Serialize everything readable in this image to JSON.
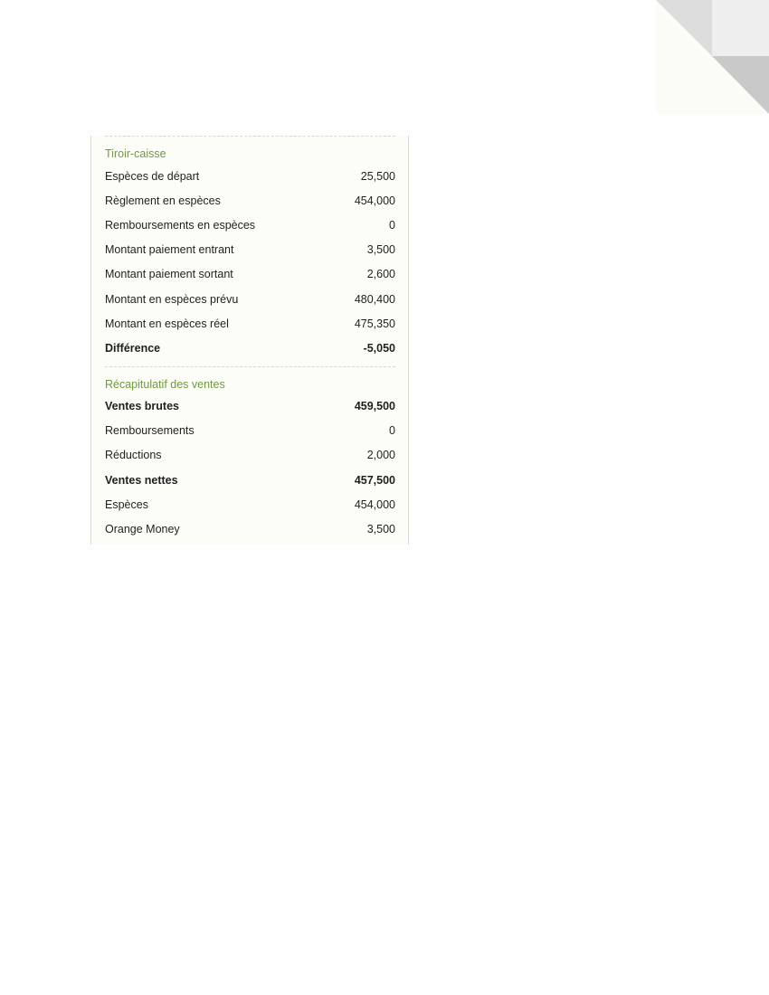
{
  "drawer": {
    "title": "Tiroir-caisse",
    "rows": [
      {
        "label": "Espèces de départ",
        "value": "25,500",
        "bold": false
      },
      {
        "label": "Règlement en espèces",
        "value": "454,000",
        "bold": false
      },
      {
        "label": "Remboursements en espèces",
        "value": "0",
        "bold": false
      },
      {
        "label": "Montant paiement entrant",
        "value": "3,500",
        "bold": false
      },
      {
        "label": "Montant paiement sortant",
        "value": "2,600",
        "bold": false
      },
      {
        "label": "Montant en espèces prévu",
        "value": "480,400",
        "bold": false
      },
      {
        "label": "Montant en espèces réel",
        "value": "475,350",
        "bold": false
      },
      {
        "label": "Différence",
        "value": "-5,050",
        "bold": true
      }
    ]
  },
  "sales_summary": {
    "title": "Récapitulatif des ventes",
    "rows": [
      {
        "label": "Ventes brutes",
        "value": "459,500",
        "bold": true
      },
      {
        "label": "Remboursements",
        "value": "0",
        "bold": false
      },
      {
        "label": "Réductions",
        "value": "2,000",
        "bold": false
      },
      {
        "label": "Ventes nettes",
        "value": "457,500",
        "bold": true
      },
      {
        "label": "Espèces",
        "value": "454,000",
        "bold": false
      },
      {
        "label": "Orange Money",
        "value": "3,500",
        "bold": false
      }
    ]
  },
  "colors": {
    "section_title": "#6f9a3f",
    "receipt_background": "#fdfdf7",
    "text": "#1f1f1f"
  }
}
